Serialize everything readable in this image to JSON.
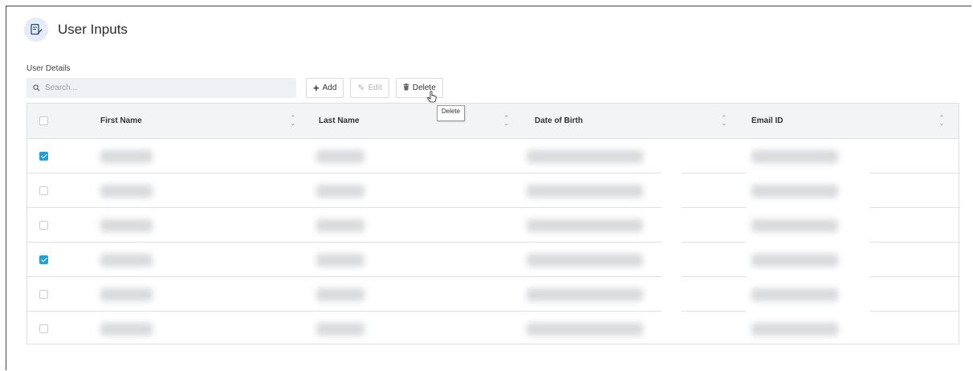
{
  "header": {
    "title": "User Inputs",
    "icon": "form-edit-icon"
  },
  "section": {
    "label": "User Details"
  },
  "search": {
    "placeholder": "Search...",
    "value": ""
  },
  "toolbar": {
    "add_label": "Add",
    "edit_label": "Edit",
    "delete_label": "Delete"
  },
  "tooltip": {
    "text": "Delete"
  },
  "table": {
    "columns": [
      "First Name",
      "Last Name",
      "Date of Birth",
      "Email ID"
    ],
    "rows": [
      {
        "checked": true
      },
      {
        "checked": false
      },
      {
        "checked": false
      },
      {
        "checked": true
      },
      {
        "checked": false
      },
      {
        "checked": false
      }
    ]
  },
  "colors": {
    "accent": "#1f9fe0",
    "header_bg": "#f3f4f6",
    "search_bg": "#eef0f3"
  }
}
